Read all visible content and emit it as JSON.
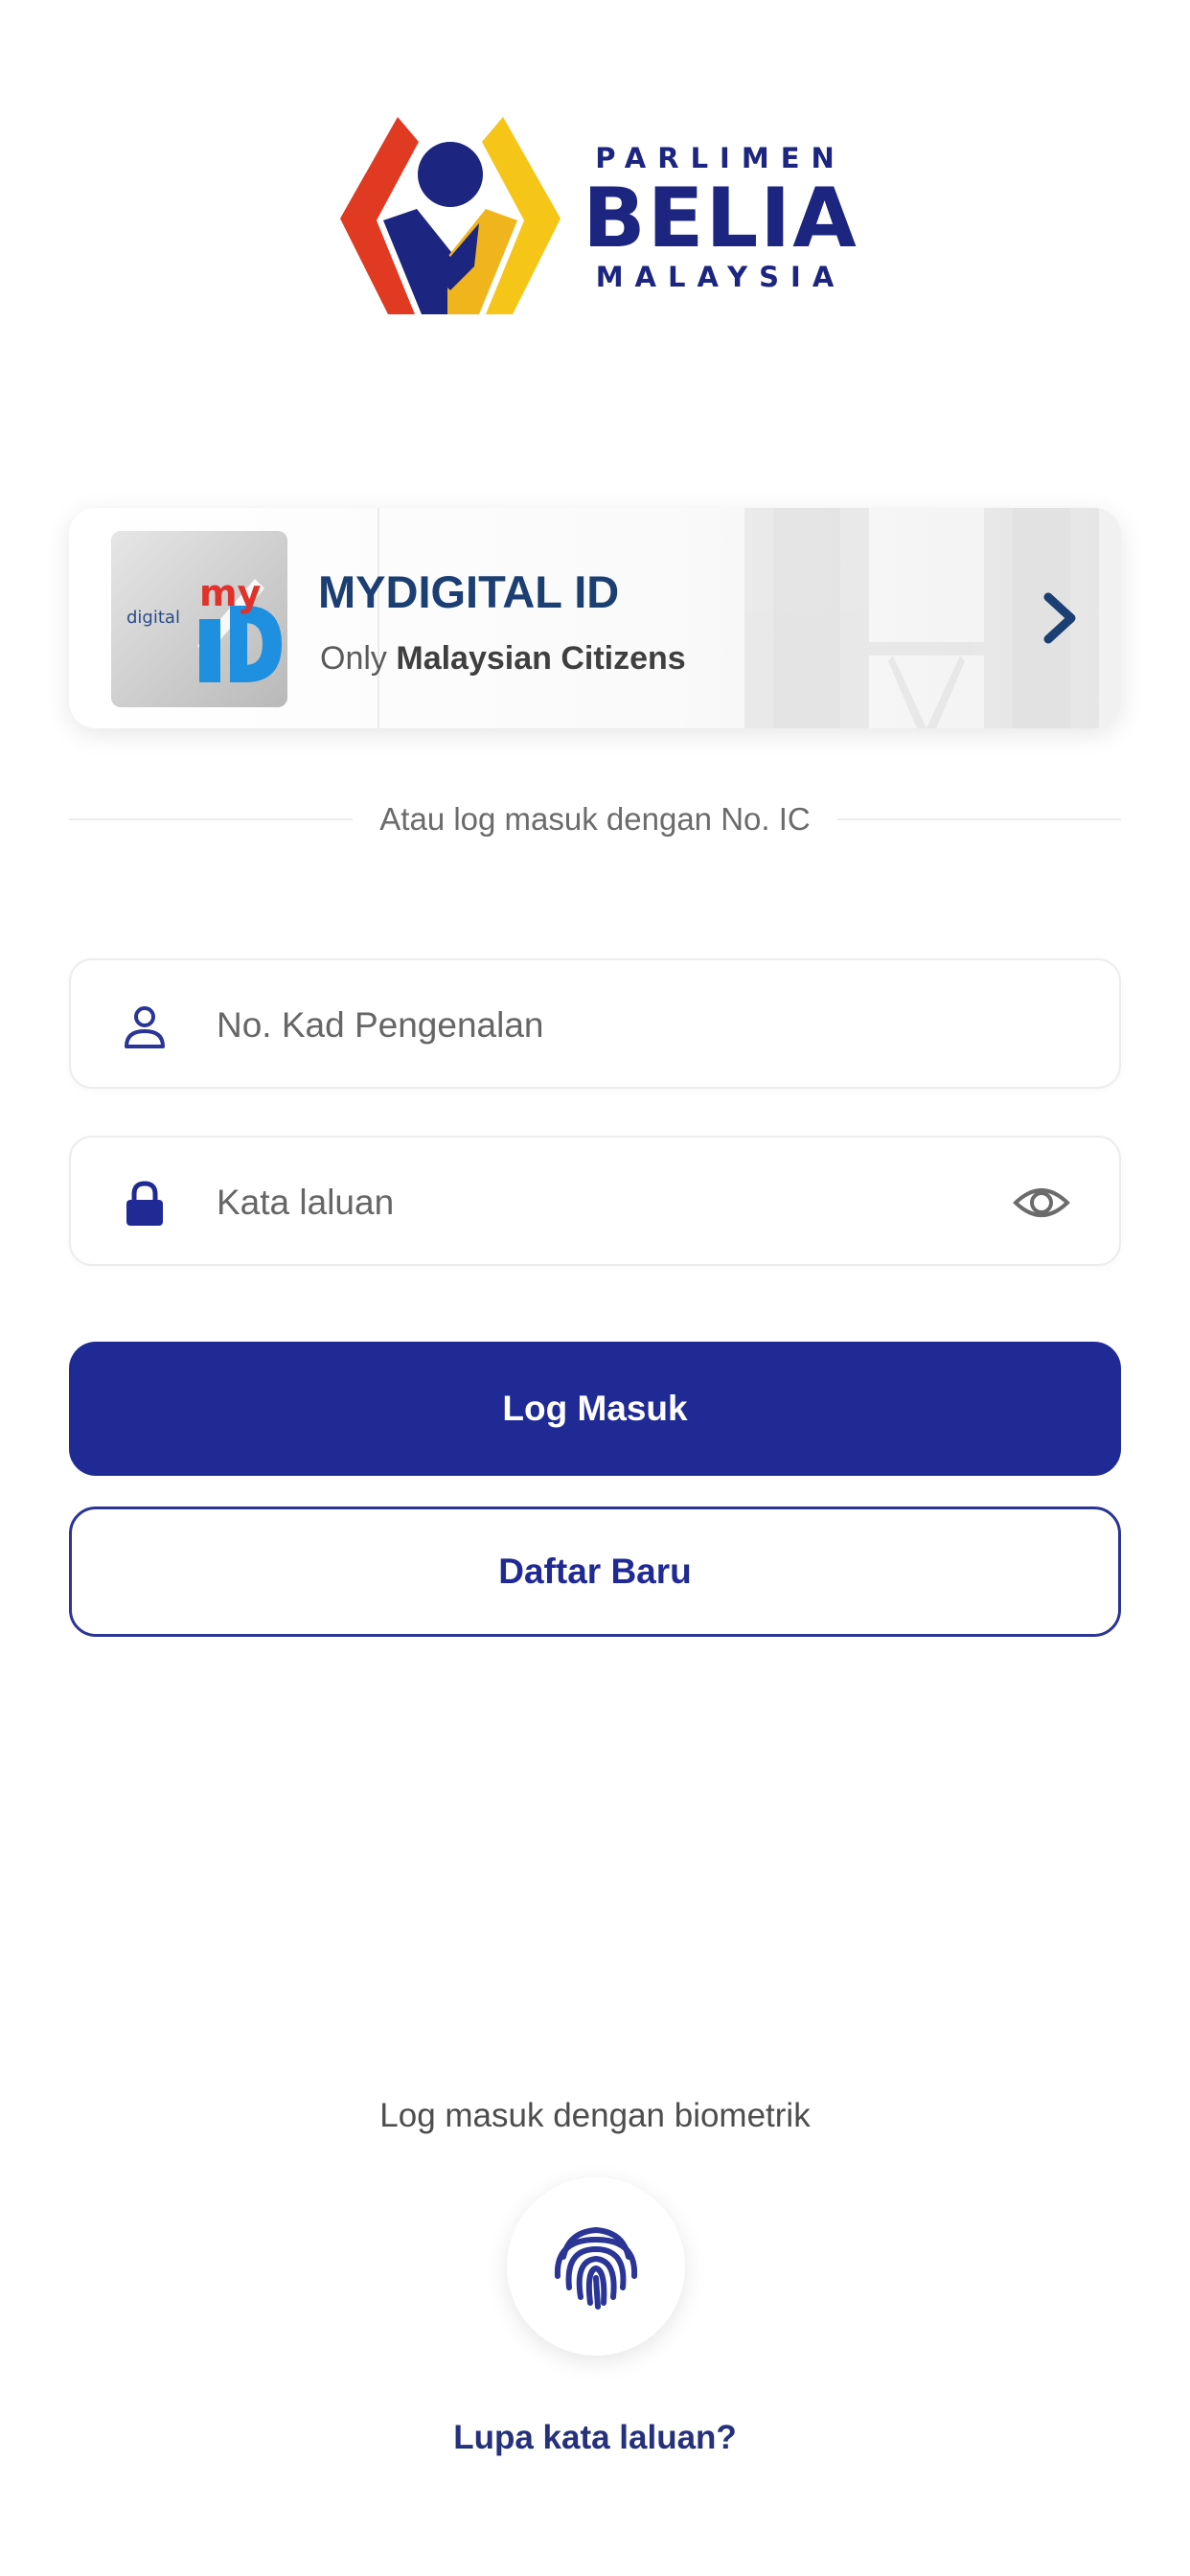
{
  "logo": {
    "line1": "PARLIMEN",
    "line2": "BELIA",
    "line3": "MALAYSIA",
    "icon": "parlimen-belia-emblem"
  },
  "mydigital": {
    "logo_small": "my",
    "logo_digital": "digital",
    "logo_id": "ID",
    "title": "MYDIGITAL ID",
    "sub_prefix": "Only",
    "sub_bold": "Malaysian Citizens",
    "icon": "chevron-right-icon"
  },
  "divider_text": "Atau log masuk dengan No. IC",
  "ic_field": {
    "placeholder": "No. Kad Pengenalan",
    "icon": "user-icon"
  },
  "password_field": {
    "placeholder": "Kata laluan",
    "icon": "lock-icon",
    "toggle_icon": "eye-icon"
  },
  "buttons": {
    "login": "Log Masuk",
    "register": "Daftar Baru"
  },
  "biometric": {
    "label": "Log masuk dengan biometrik",
    "icon": "fingerprint-icon"
  },
  "forgot_password": "Lupa kata laluan?",
  "colors": {
    "primary": "#1f2a94",
    "title_blue": "#1c3f73",
    "logo_navy": "#1c2580",
    "logo_red": "#e03a22",
    "logo_yellow": "#f5c518"
  }
}
